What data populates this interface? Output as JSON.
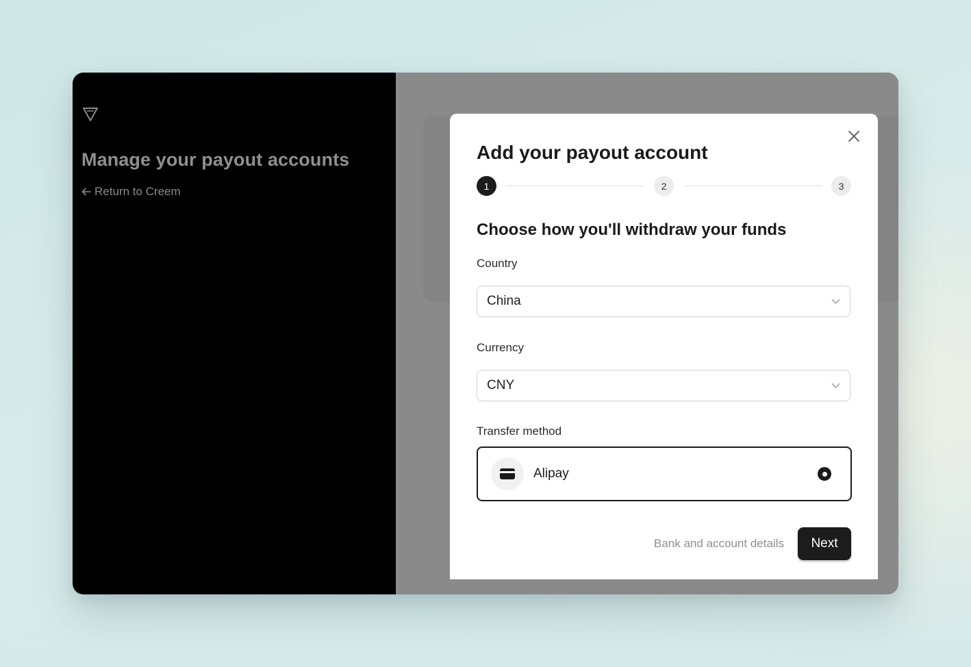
{
  "sidebar": {
    "title": "Manage your payout accounts",
    "return_label": "Return to Creem"
  },
  "modal": {
    "title": "Add your payout account",
    "steps": [
      "1",
      "2",
      "3"
    ],
    "active_step": 1,
    "section_title": "Choose how you'll withdraw your funds",
    "country": {
      "label": "Country",
      "value": "China"
    },
    "currency": {
      "label": "Currency",
      "value": "CNY"
    },
    "transfer": {
      "label": "Transfer method",
      "option": "Alipay",
      "selected": true
    },
    "footer_hint": "Bank and account details",
    "next_label": "Next"
  },
  "icons": {
    "logo": "triangle-logo-icon",
    "back": "arrow-left-icon",
    "close": "close-icon",
    "chevron": "chevron-down-icon",
    "method": "wallet-card-icon"
  },
  "colors": {
    "accent": "#1c1c1c",
    "overlay": "#8a8a8a",
    "sidebar_bg": "#000000"
  }
}
